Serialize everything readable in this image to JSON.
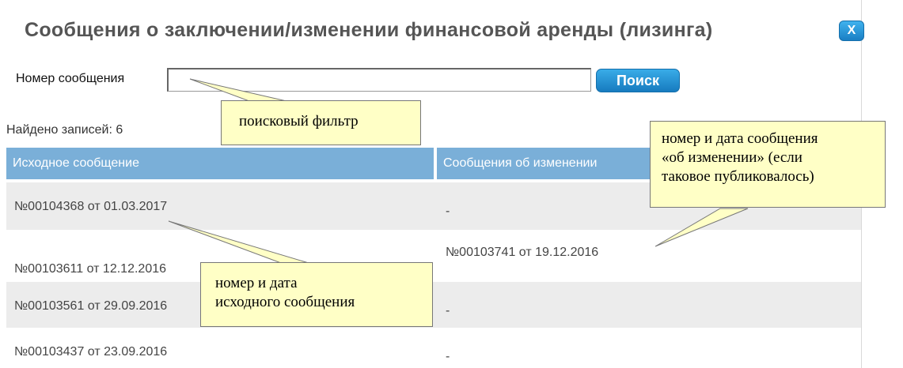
{
  "dialog": {
    "title": "Сообщения о заключении/изменении финансовой аренды (лизинга)",
    "close_label": "X"
  },
  "search": {
    "label": "Номер сообщения",
    "value": "",
    "placeholder": "",
    "button_label": "Поиск"
  },
  "results": {
    "found_text": "Найдено записей: 6"
  },
  "table": {
    "columns": [
      "Исходное сообщение",
      "Сообщения об изменении"
    ],
    "rows": [
      {
        "original": "№00104368 от 01.03.2017",
        "change": "-"
      },
      {
        "original": "№00103611 от 12.12.2016",
        "change": "№00103741 от 19.12.2016"
      },
      {
        "original": "№00103561 от 29.09.2016",
        "change": "-"
      },
      {
        "original": "№00103437 от 23.09.2016",
        "change": "-"
      }
    ]
  },
  "callouts": {
    "search_filter": "поисковый фильтр",
    "change_msg_line1": "номер и дата сообщения",
    "change_msg_line2": "«об изменении» (если",
    "change_msg_line3": "таковое публиковалось)",
    "original_msg_line1": "номер и дата",
    "original_msg_line2": "исходного сообщения"
  },
  "colors": {
    "header_bg": "#7aafd8",
    "button_blue": "#1a7fc4",
    "callout_bg": "#ffffc6",
    "row_alt": "#ececec"
  }
}
